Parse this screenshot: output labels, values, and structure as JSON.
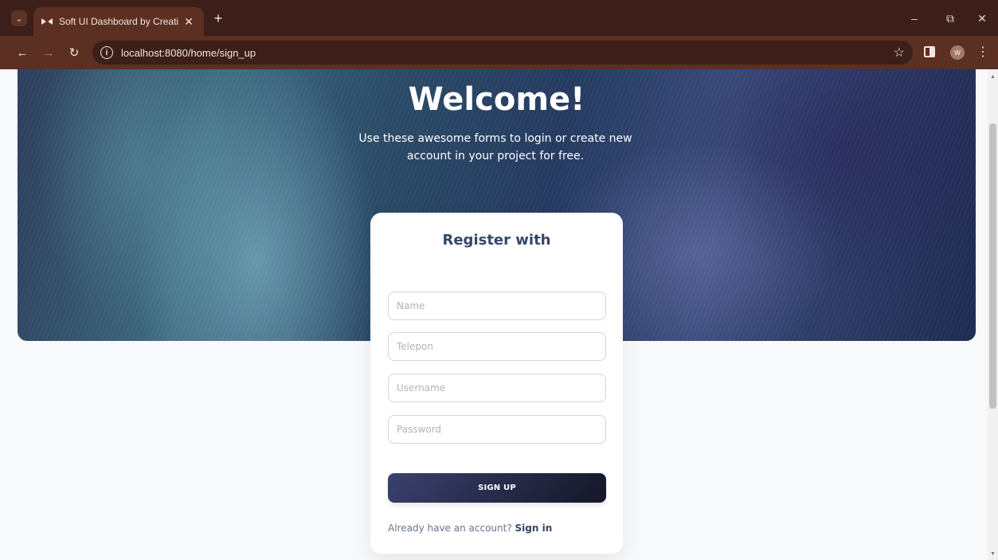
{
  "browser": {
    "tab_title": "Soft UI Dashboard by Creative",
    "url": "localhost:8080/home/sign_up",
    "profile_initial": "W"
  },
  "hero": {
    "title": "Welcome!",
    "subtitle": "Use these awesome forms to login or create new account in your project for free."
  },
  "form": {
    "title": "Register with",
    "fields": [
      {
        "placeholder": "Name",
        "value": ""
      },
      {
        "placeholder": "Telepon",
        "value": ""
      },
      {
        "placeholder": "Username",
        "value": ""
      },
      {
        "placeholder": "Password",
        "value": ""
      }
    ],
    "submit_label": "SIGN UP",
    "signin_prompt": "Already have an account?",
    "signin_link": "Sign in"
  },
  "icons": {
    "tab_menu": "chevron-down-icon",
    "favicon": "soft-ui-logo-icon",
    "tab_close": "close-icon",
    "new_tab": "plus-icon",
    "back": "arrow-left-icon",
    "forward": "arrow-right-icon",
    "reload": "reload-icon",
    "site_info": "info-icon",
    "bookmark": "star-icon",
    "side_panel": "side-panel-icon",
    "menu": "kebab-menu-icon"
  },
  "colors": {
    "chrome_dark": "#3b1f18",
    "chrome_toolbar": "#5b2f22",
    "page_bg": "#f8f9fa",
    "heading": "#344767",
    "text_muted": "#67748e",
    "button_start": "#3a416f",
    "button_end": "#141727"
  }
}
